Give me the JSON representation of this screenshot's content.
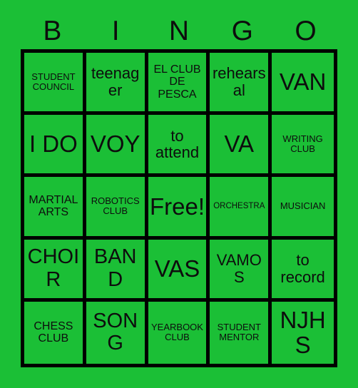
{
  "card": {
    "background_color": "#1BBF36",
    "cell_color": "#1BBF36",
    "border_color": "#000000",
    "text_color": "#0d0d0d"
  },
  "header": {
    "letters": [
      "B",
      "I",
      "N",
      "G",
      "O"
    ]
  },
  "grid": {
    "columns": 5,
    "rows": 5,
    "cells": [
      {
        "text": "STUDENT COUNCIL",
        "size": "size-xs",
        "column": "B",
        "row": 1
      },
      {
        "text": "teenager",
        "size": "size-md",
        "column": "I",
        "row": 1
      },
      {
        "text": "EL CLUB DE PESCA",
        "size": "size-sm",
        "column": "N",
        "row": 1
      },
      {
        "text": "rehearsal",
        "size": "size-md",
        "column": "G",
        "row": 1
      },
      {
        "text": "VAN",
        "size": "size-xl",
        "column": "O",
        "row": 1
      },
      {
        "text": "I DO",
        "size": "size-xl",
        "column": "B",
        "row": 2
      },
      {
        "text": "VOY",
        "size": "size-xl",
        "column": "I",
        "row": 2
      },
      {
        "text": "to attend",
        "size": "size-md",
        "column": "N",
        "row": 2
      },
      {
        "text": "VA",
        "size": "size-xl",
        "column": "G",
        "row": 2
      },
      {
        "text": "WRITING CLUB",
        "size": "size-xs",
        "column": "O",
        "row": 2
      },
      {
        "text": "MARTIAL ARTS",
        "size": "size-sm",
        "column": "B",
        "row": 3
      },
      {
        "text": "ROBOTICS CLUB",
        "size": "size-xs",
        "column": "I",
        "row": 3
      },
      {
        "text": "Free!",
        "size": "size-xl",
        "column": "N",
        "row": 3
      },
      {
        "text": "ORCHESTRA",
        "size": "size-xxs",
        "column": "G",
        "row": 3
      },
      {
        "text": "MUSICIAN",
        "size": "size-xs",
        "column": "O",
        "row": 3
      },
      {
        "text": "CHOIR",
        "size": "size-lg",
        "column": "B",
        "row": 4
      },
      {
        "text": "BAND",
        "size": "size-lg",
        "column": "I",
        "row": 4
      },
      {
        "text": "VAS",
        "size": "size-xl",
        "column": "N",
        "row": 4
      },
      {
        "text": "VAMOS",
        "size": "size-md",
        "column": "G",
        "row": 4
      },
      {
        "text": "to record",
        "size": "size-md",
        "column": "O",
        "row": 4
      },
      {
        "text": "CHESS CLUB",
        "size": "size-sm",
        "column": "B",
        "row": 5
      },
      {
        "text": "SONG",
        "size": "size-lg",
        "column": "I",
        "row": 5
      },
      {
        "text": "YEARBOOK CLUB",
        "size": "size-xs",
        "column": "N",
        "row": 5
      },
      {
        "text": "STUDENT MENTOR",
        "size": "size-xs",
        "column": "G",
        "row": 5
      },
      {
        "text": "NJHS",
        "size": "size-xl",
        "column": "O",
        "row": 5
      }
    ]
  }
}
